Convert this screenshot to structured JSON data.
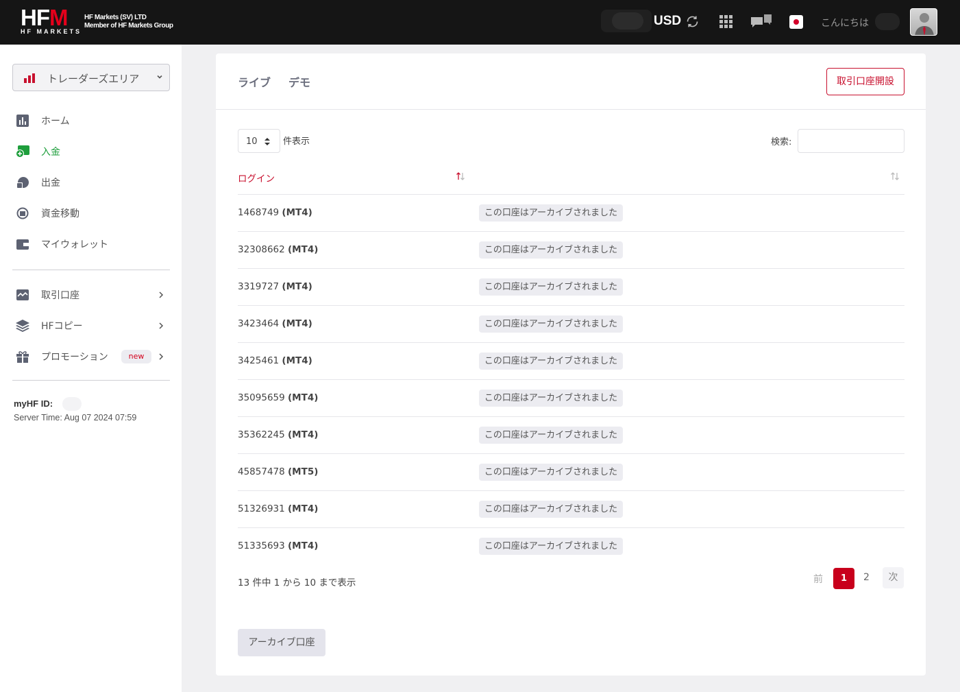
{
  "header": {
    "logo_text": "HFM",
    "logo_sub": "HF MARKETS",
    "company_line1": "HF Markets (SV) LTD",
    "company_line2": "Member of HF Markets Group",
    "currency": "USD",
    "greeting": "こんにちは",
    "icons": [
      "refresh-icon",
      "apps-grid-icon",
      "chat-icon",
      "japan-flag-icon",
      "avatar-icon"
    ]
  },
  "sidebar": {
    "area_label": "トレーダーズエリア",
    "items": [
      {
        "label": "ホーム",
        "icon": "chart-bar-icon"
      },
      {
        "label": "入金",
        "icon": "deposit-icon",
        "active": true
      },
      {
        "label": "出金",
        "icon": "withdraw-icon"
      },
      {
        "label": "資金移動",
        "icon": "transfer-icon"
      },
      {
        "label": "マイウォレット",
        "icon": "wallet-icon"
      },
      {
        "label": "取引口座",
        "icon": "trading-account-icon"
      },
      {
        "label": "HFコピー",
        "icon": "layers-icon"
      },
      {
        "label": "プロモーション",
        "icon": "gift-icon",
        "badge": "new"
      }
    ],
    "myhf_label": "myHF ID:",
    "server_time": "Server Time: Aug 07 2024 07:59"
  },
  "main": {
    "tabs": [
      "ライブ",
      "デモ"
    ],
    "open_account_button": "取引口座開設",
    "length_value": "10",
    "length_label": "件表示",
    "search_label": "検索:",
    "search_value": "",
    "column_login": "ログイン",
    "rows": [
      {
        "id": "1468749",
        "platform": "(MT4)",
        "status": "この口座はアーカイブされました"
      },
      {
        "id": "32308662",
        "platform": "(MT4)",
        "status": "この口座はアーカイブされました"
      },
      {
        "id": "3319727",
        "platform": "(MT4)",
        "status": "この口座はアーカイブされました"
      },
      {
        "id": "3423464",
        "platform": "(MT4)",
        "status": "この口座はアーカイブされました"
      },
      {
        "id": "3425461",
        "platform": "(MT4)",
        "status": "この口座はアーカイブされました"
      },
      {
        "id": "35095659",
        "platform": "(MT4)",
        "status": "この口座はアーカイブされました"
      },
      {
        "id": "35362245",
        "platform": "(MT4)",
        "status": "この口座はアーカイブされました"
      },
      {
        "id": "45857478",
        "platform": "(MT5)",
        "status": "この口座はアーカイブされました"
      },
      {
        "id": "51326931",
        "platform": "(MT4)",
        "status": "この口座はアーカイブされました"
      },
      {
        "id": "51335693",
        "platform": "(MT4)",
        "status": "この口座はアーカイブされました"
      }
    ],
    "info_text": "13 件中 1 から 10 まで表示",
    "pagination": {
      "prev": "前",
      "page1": "1",
      "page2": "2",
      "next": "次",
      "current": 1
    },
    "archive_button": "アーカイブ口座"
  },
  "colors": {
    "brand_red": "#c8102e",
    "active_green": "#1e9e3c",
    "topbar": "#151515"
  }
}
